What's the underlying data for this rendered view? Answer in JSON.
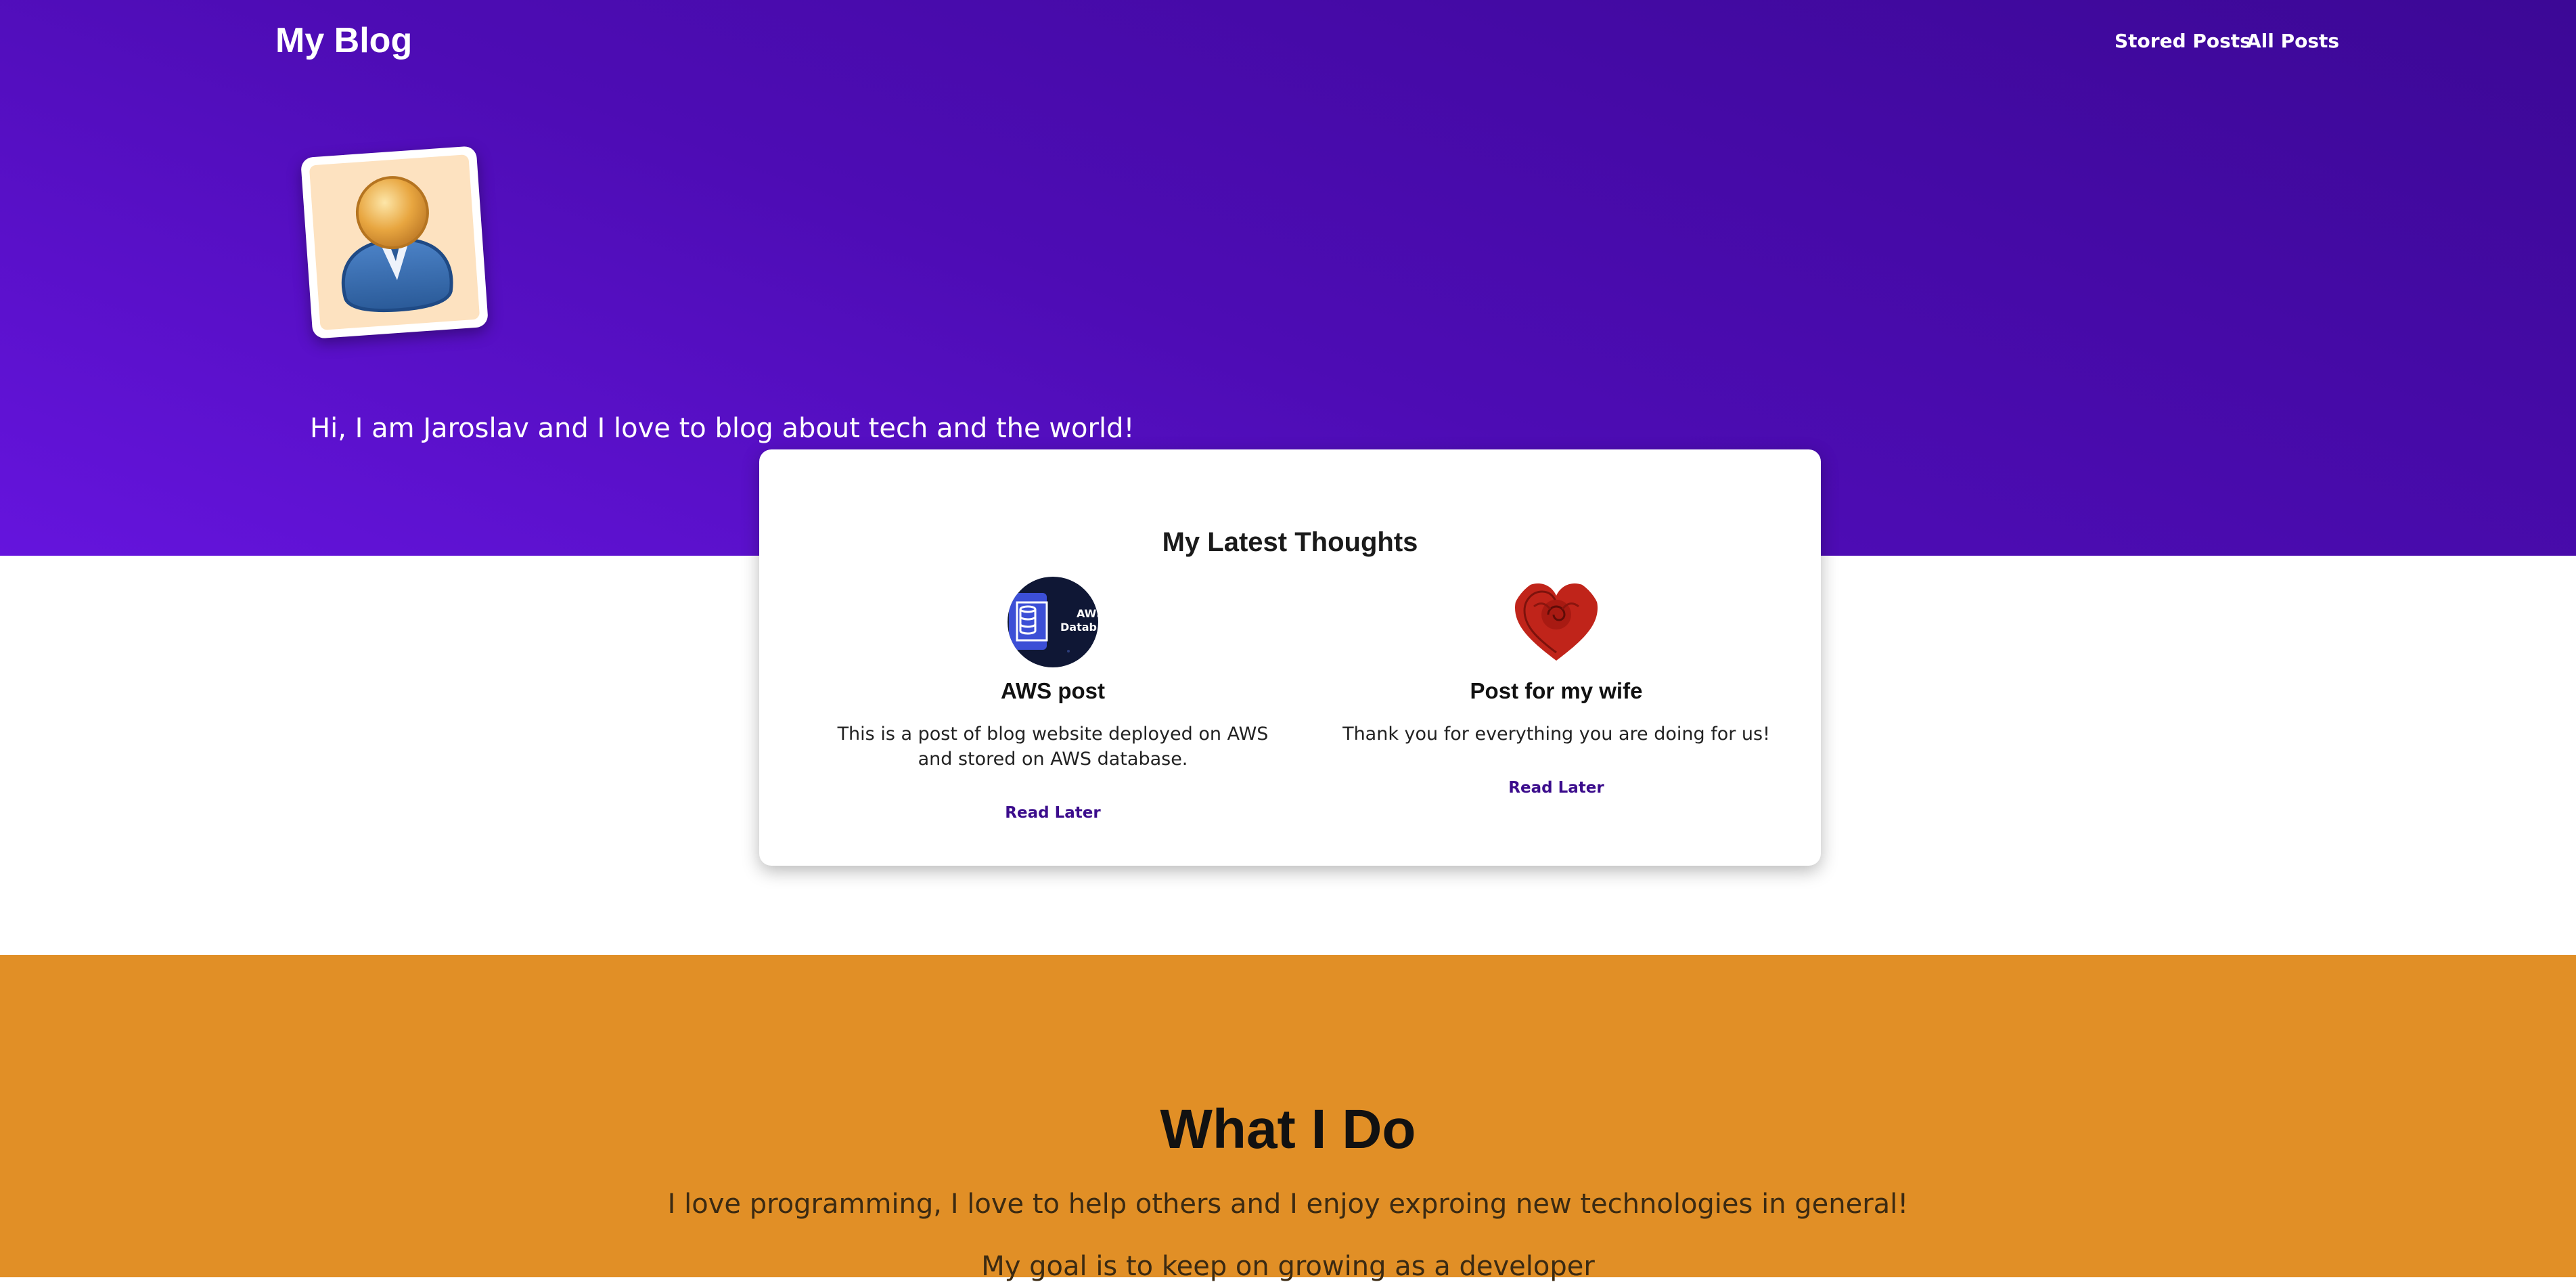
{
  "nav": {
    "brand": "My Blog",
    "links": [
      "Stored Posts",
      "All Posts"
    ]
  },
  "hero": {
    "intro": "Hi, I am Jaroslav and I love to blog about tech and the world!",
    "avatar_icon": "user-avatar-icon",
    "colors": {
      "gradient_start": "#6514dd",
      "gradient_end": "#3c0896"
    }
  },
  "latest": {
    "title": "My Latest Thoughts",
    "posts": [
      {
        "title": "AWS post",
        "text": "This is a post of blog website deployed on AWS and stored on AWS database.",
        "image_caption": "AWS\nDatab",
        "image_icon": "aws-database-image",
        "action": "Read Later"
      },
      {
        "title": "Post for my wife",
        "text": "Thank you for everything you are doing for us!",
        "image_icon": "heart-rose-image",
        "action": "Read Later"
      }
    ]
  },
  "what_i_do": {
    "title": "What I Do",
    "lines": [
      "I love programming, I love to help others and I enjoy exproing new technologies in general!",
      "My goal is to keep on growing as a developer"
    ],
    "color": "#e18f26"
  }
}
